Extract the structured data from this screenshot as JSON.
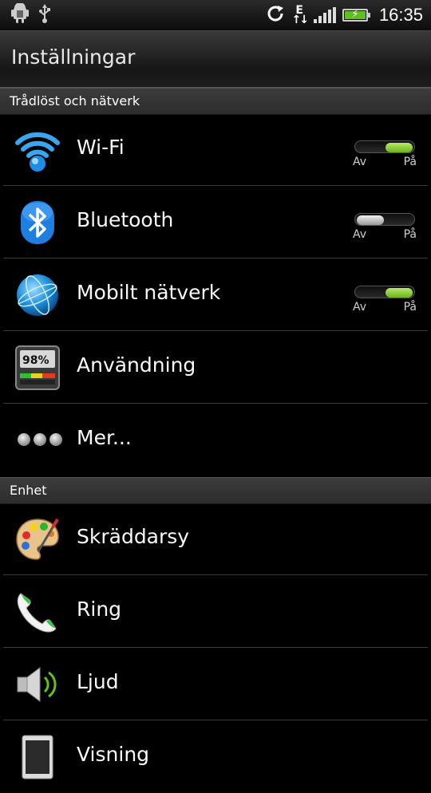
{
  "statusbar": {
    "time": "16:35",
    "network_type": "E",
    "icons": [
      "android-debug-icon",
      "usb-icon",
      "sync-icon",
      "edge-data-icon",
      "signal-icon",
      "battery-charging-icon"
    ]
  },
  "titlebar": {
    "title": "Inställningar"
  },
  "sections": {
    "wireless": {
      "header": "Trådlöst och nätverk"
    },
    "device": {
      "header": "Enhet"
    }
  },
  "rows": {
    "wifi": {
      "label": "Wi-Fi",
      "toggle_off": "Av",
      "toggle_on": "På",
      "state": "on"
    },
    "bluetooth": {
      "label": "Bluetooth",
      "toggle_off": "Av",
      "toggle_on": "På",
      "state": "off"
    },
    "mobile": {
      "label": "Mobilt nätverk",
      "toggle_off": "Av",
      "toggle_on": "På",
      "state": "on"
    },
    "usage": {
      "label": "Användning",
      "icon_text": "98%"
    },
    "more": {
      "label": "Mer..."
    },
    "personalize": {
      "label": "Skräddarsy"
    },
    "ring": {
      "label": "Ring"
    },
    "sound": {
      "label": "Ljud"
    },
    "display": {
      "label": "Visning"
    }
  },
  "colors": {
    "toggle_on": "#7cc225",
    "background": "#000000",
    "header_bg": "#333333"
  }
}
